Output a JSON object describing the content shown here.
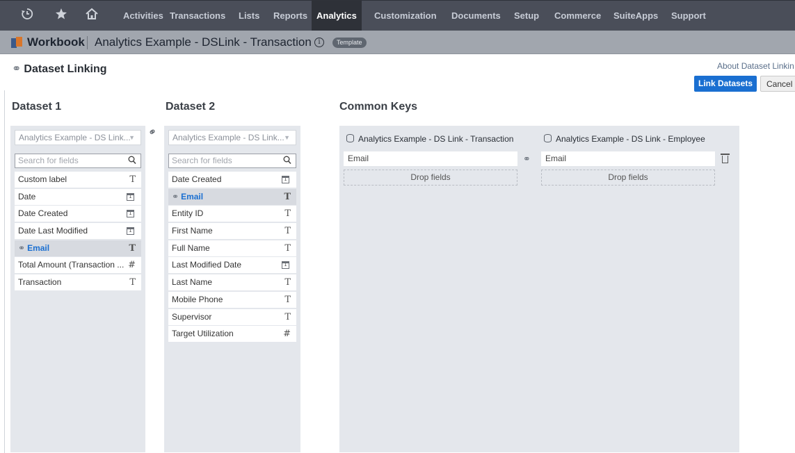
{
  "topnav": {
    "icons": [
      "recent-icon",
      "star-icon",
      "home-icon"
    ],
    "items": [
      "Activities",
      "Transactions",
      "Lists",
      "Reports",
      "Analytics",
      "Customization",
      "Documents",
      "Setup",
      "Commerce",
      "SuiteApps",
      "Support"
    ],
    "active": "Analytics"
  },
  "titlebar": {
    "label": "Workbook",
    "name": "Analytics Example - DSLink - Transaction",
    "info_icon": "ⓘ",
    "badge": "Template"
  },
  "header": {
    "title": "Dataset Linking",
    "about": "About Dataset Linkin",
    "link_button": "Link Datasets",
    "cancel_button": "Cancel"
  },
  "dataset1": {
    "heading": "Dataset 1",
    "selected": "Analytics Example - DS Link...",
    "search_placeholder": "Search for fields",
    "fields": [
      {
        "label": "Custom label",
        "type": "text"
      },
      {
        "label": "Date",
        "type": "date"
      },
      {
        "label": "Date Created",
        "type": "date"
      },
      {
        "label": "Date Last Modified",
        "type": "date"
      },
      {
        "label": "Email",
        "type": "text",
        "linked": true
      },
      {
        "label": "Total Amount (Transaction ...",
        "type": "number"
      },
      {
        "label": "Transaction",
        "type": "text"
      }
    ]
  },
  "dataset2": {
    "heading": "Dataset 2",
    "selected": "Analytics Example - DS Link...",
    "search_placeholder": "Search for fields",
    "fields": [
      {
        "label": "Date Created",
        "type": "date"
      },
      {
        "label": "Email",
        "type": "text",
        "linked": true
      },
      {
        "label": "Entity ID",
        "type": "text"
      },
      {
        "label": "First Name",
        "type": "text"
      },
      {
        "label": "Full Name",
        "type": "text"
      },
      {
        "label": "Last Modified Date",
        "type": "date"
      },
      {
        "label": "Last Name",
        "type": "text"
      },
      {
        "label": "Mobile Phone",
        "type": "text"
      },
      {
        "label": "Supervisor",
        "type": "text"
      },
      {
        "label": "Target Utilization",
        "type": "number"
      }
    ]
  },
  "common_keys": {
    "heading": "Common Keys",
    "dataset1_name": "Analytics Example - DS Link - Transaction",
    "dataset2_name": "Analytics Example - DS Link - Employee",
    "key1": "Email",
    "key2": "Email",
    "drop_label": "Drop fields"
  },
  "glyphs": {
    "type_text": "T",
    "type_number": "#",
    "type_date": "1",
    "link": "⚭",
    "search": "⚲",
    "caret": "▼"
  }
}
